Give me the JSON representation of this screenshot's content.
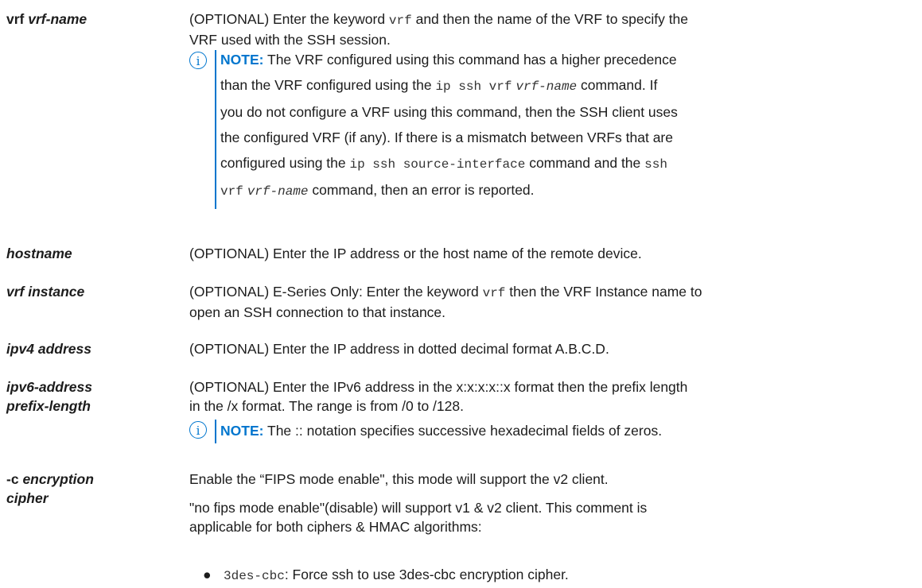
{
  "rows": {
    "vrf": {
      "term_keyword": "vrf",
      "term_arg": "vrf-name",
      "desc_a": "(OPTIONAL) Enter the keyword ",
      "desc_code": "vrf",
      "desc_b": " and then the name of the VRF to specify the",
      "desc_line2": "VRF used with the SSH session.",
      "note": {
        "label": "NOTE:",
        "t1": " The VRF configured using this command has a higher precedence",
        "t2a": "than the VRF configured using the ",
        "t2code": "ip ssh vrf",
        "t2arg": "vrf-name",
        "t2b": " command. If",
        "t3": "you do not configure a VRF using this command, then the SSH client uses",
        "t4": "the configured VRF (if any). If there is a mismatch between VRFs that are",
        "t5a": "configured using the ",
        "t5code": "ip ssh source-interface",
        "t5b": " command and the ",
        "t5code2": "ssh",
        "t6code": "vrf",
        "t6arg": "vrf-name",
        "t6b": " command, then an error is reported."
      }
    },
    "hostname": {
      "term": "hostname",
      "desc": "(OPTIONAL) Enter the IP address or the host name of the remote device."
    },
    "vrf_instance": {
      "term": "vrf instance",
      "desc_a": "(OPTIONAL) E-Series Only: Enter the keyword ",
      "desc_code": "vrf",
      "desc_b": " then the VRF Instance name to",
      "desc_line2": "open an SSH connection to that instance."
    },
    "ipv4": {
      "term": "ipv4 address",
      "desc": "(OPTIONAL) Enter the IP address in dotted decimal format A.B.C.D."
    },
    "ipv6": {
      "term_line1": "ipv6-address",
      "term_line2": "prefix-length",
      "desc_line1": "(OPTIONAL) Enter the IPv6 address in the x:x:x:x::x format then the prefix length",
      "desc_line2": "in the /x format. The range is from /0 to /128.",
      "note": {
        "label": "NOTE:",
        "text": " The :: notation specifies successive hexadecimal fields of zeros."
      }
    },
    "cipher": {
      "term_keyword": "-c",
      "term_arg1": "encryption",
      "term_arg2": "cipher",
      "p1": "Enable the “FIPS mode enable\", this mode will support the v2 client.",
      "p2_line1": "\"no fips mode enable\"(disable) will support v1 & v2 client. This comment is",
      "p2_line2": "applicable for both ciphers & HMAC algorithms:",
      "bullet_dot": "●",
      "bullet_code": "3des-cbc",
      "bullet_text": ": Force ssh to use 3des-cbc encryption cipher."
    }
  },
  "icons": {
    "note": "info-circle-icon",
    "note_glyph": "i"
  },
  "colors": {
    "accent": "#0076ce",
    "text": "#1c1c1c"
  }
}
